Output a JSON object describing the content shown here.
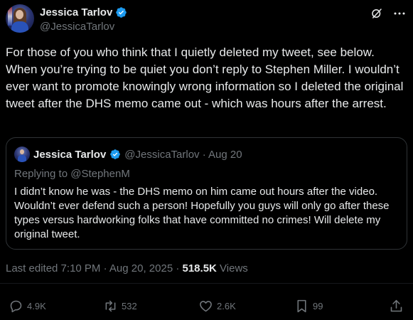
{
  "author": {
    "display_name": "Jessica Tarlov",
    "handle": "@JessicaTarlov",
    "verified": true,
    "verified_color": "#1d9bf0"
  },
  "top_icons": [
    "grok-icon",
    "more-icon"
  ],
  "tweet": {
    "text": "For those of you who think that I quietly deleted my tweet, see below. When you’re trying to be quiet you don’t reply to Stephen Miller. I wouldn’t ever want to promote knowingly wrong information so I deleted the original tweet after the DHS memo came out - which was hours after the arrest."
  },
  "quote": {
    "display_name": "Jessica Tarlov",
    "handle_date": "@JessicaTarlov · Aug 20",
    "replying_to": "Replying to @StephenM",
    "text": "I didn’t know he was - the DHS memo on him came out hours after the video. Wouldn’t ever defend such a person! Hopefully you guys will only go after these types versus hardworking folks that have committed no crimes! Will delete my original tweet."
  },
  "meta": {
    "edited": "Last edited 7:10 PM · Aug 20, 2025 · ",
    "views_count": "518.5K",
    "views_label": " Views"
  },
  "actions": {
    "replies": "4.9K",
    "reposts": "532",
    "likes": "2.6K",
    "bookmarks": "99"
  },
  "colors": {
    "background": "#000000",
    "text": "#e7e9ea",
    "secondary": "#71767b",
    "border": "#2f3336"
  }
}
